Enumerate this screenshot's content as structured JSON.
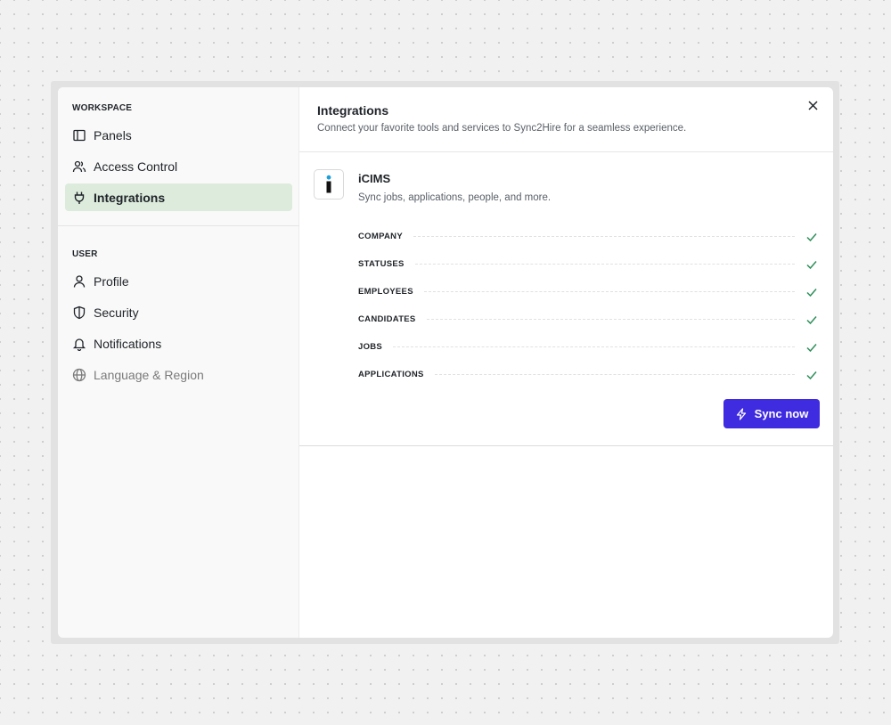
{
  "sidebar": {
    "workspace_label": "WORKSPACE",
    "workspace_items": [
      {
        "label": "Panels",
        "icon": "panel-icon"
      },
      {
        "label": "Access Control",
        "icon": "users-icon"
      },
      {
        "label": "Integrations",
        "icon": "plug-icon",
        "active": true
      }
    ],
    "user_label": "USER",
    "user_items": [
      {
        "label": "Profile",
        "icon": "user-icon"
      },
      {
        "label": "Security",
        "icon": "shield-icon"
      },
      {
        "label": "Notifications",
        "icon": "bell-icon"
      },
      {
        "label": "Language & Region",
        "icon": "globe-icon",
        "muted": true
      }
    ]
  },
  "header": {
    "title": "Integrations",
    "subtitle": "Connect your favorite tools and services to Sync2Hire for a seamless experience."
  },
  "integration": {
    "name": "iCIMS",
    "logo_letter": "i",
    "description": "Sync jobs, applications, people, and more.",
    "sync_items": [
      "COMPANY",
      "STATUSES",
      "EMPLOYEES",
      "CANDIDATES",
      "JOBS",
      "APPLICATIONS"
    ],
    "sync_button_label": "Sync now"
  },
  "colors": {
    "accent": "#3f2be0",
    "active_nav_bg": "#dcebdc",
    "check": "#2f8f5b"
  }
}
